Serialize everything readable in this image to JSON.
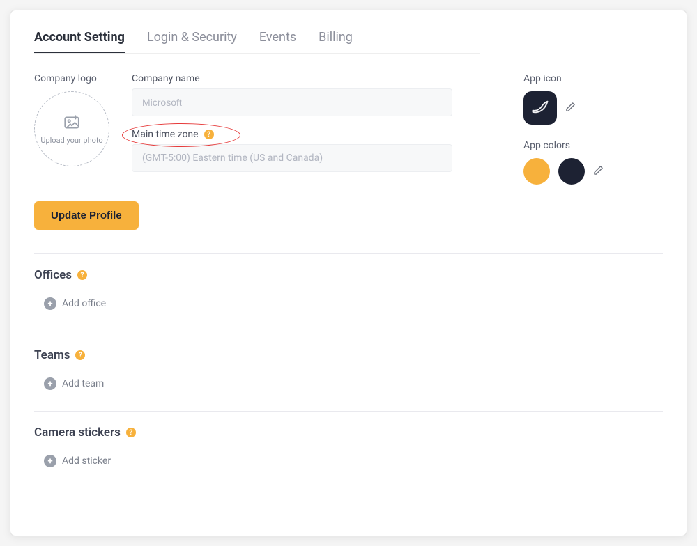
{
  "tabs": {
    "account_setting": "Account  Setting",
    "login_security": "Login & Security",
    "events": "Events",
    "billing": "Billing"
  },
  "logo": {
    "label": "Company  logo",
    "upload_caption": "Upload your photo"
  },
  "companyName": {
    "label": "Company name",
    "placeholder": "Microsoft",
    "value": ""
  },
  "timezone": {
    "label": "Main time zone",
    "placeholder": "(GMT-5:00) Eastern time (US and Canada)"
  },
  "appIcon": {
    "label": "App icon"
  },
  "appColors": {
    "label": "App colors",
    "primary": "#f7b13c",
    "secondary": "#1d2233"
  },
  "buttons": {
    "updateProfile": "Update Profile"
  },
  "sections": {
    "offices": {
      "title": "Offices",
      "add": "Add office"
    },
    "teams": {
      "title": "Teams",
      "add": "Add team"
    },
    "stickers": {
      "title": "Camera stickers",
      "add": "Add sticker"
    }
  }
}
